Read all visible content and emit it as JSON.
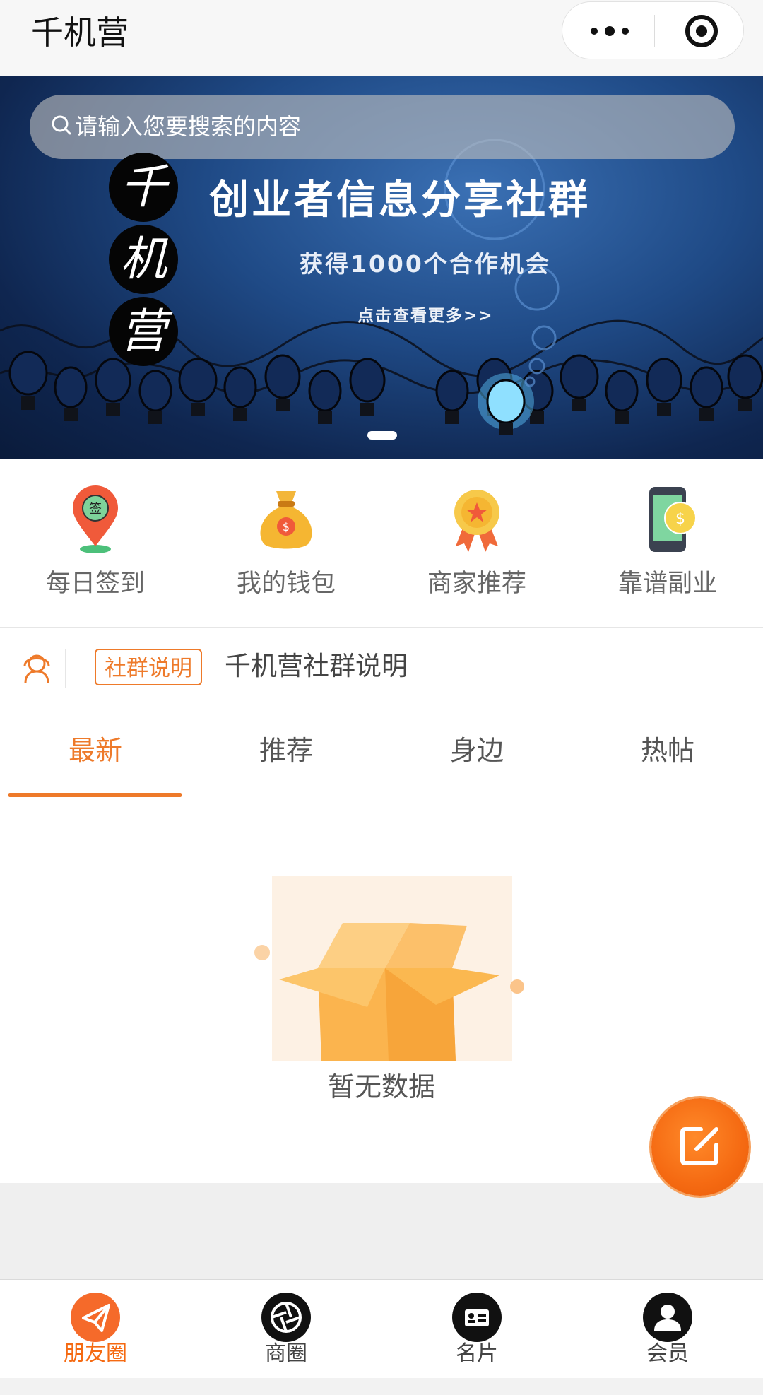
{
  "nav": {
    "title": "千机营"
  },
  "search": {
    "placeholder": "请输入您要搜索的内容"
  },
  "banner": {
    "logo_chars": [
      "千",
      "机",
      "营"
    ],
    "headline": "创业者信息分享社群",
    "subline": "获得1000个合作机会",
    "link": "点击查看更多>>",
    "slide_count": 1,
    "active_slide": 1
  },
  "quick_entries": [
    {
      "label": "每日签到",
      "icon": "map-pin-sign-icon",
      "icon_text": "签"
    },
    {
      "label": "我的钱包",
      "icon": "money-bag-icon",
      "icon_text": "$"
    },
    {
      "label": "商家推荐",
      "icon": "award-ribbon-icon"
    },
    {
      "label": "靠谱副业",
      "icon": "phone-coin-icon",
      "icon_text": "$"
    }
  ],
  "notice": {
    "badge": "社群说明",
    "text": "千机营社群说明"
  },
  "tabs": [
    {
      "label": "最新",
      "active": true
    },
    {
      "label": "推荐",
      "active": false
    },
    {
      "label": "身边",
      "active": false
    },
    {
      "label": "热帖",
      "active": false
    }
  ],
  "empty_state": {
    "text": "暂无数据"
  },
  "tabbar": [
    {
      "label": "朋友圈",
      "icon": "paper-plane-icon",
      "active": true
    },
    {
      "label": "商圈",
      "icon": "aperture-icon",
      "active": false
    },
    {
      "label": "名片",
      "icon": "business-card-icon",
      "active": false
    },
    {
      "label": "会员",
      "icon": "user-icon",
      "active": false
    }
  ],
  "colors": {
    "accent": "#ee7a2a",
    "fab": "#f56a12",
    "banner_bg": "#1f4a86"
  }
}
